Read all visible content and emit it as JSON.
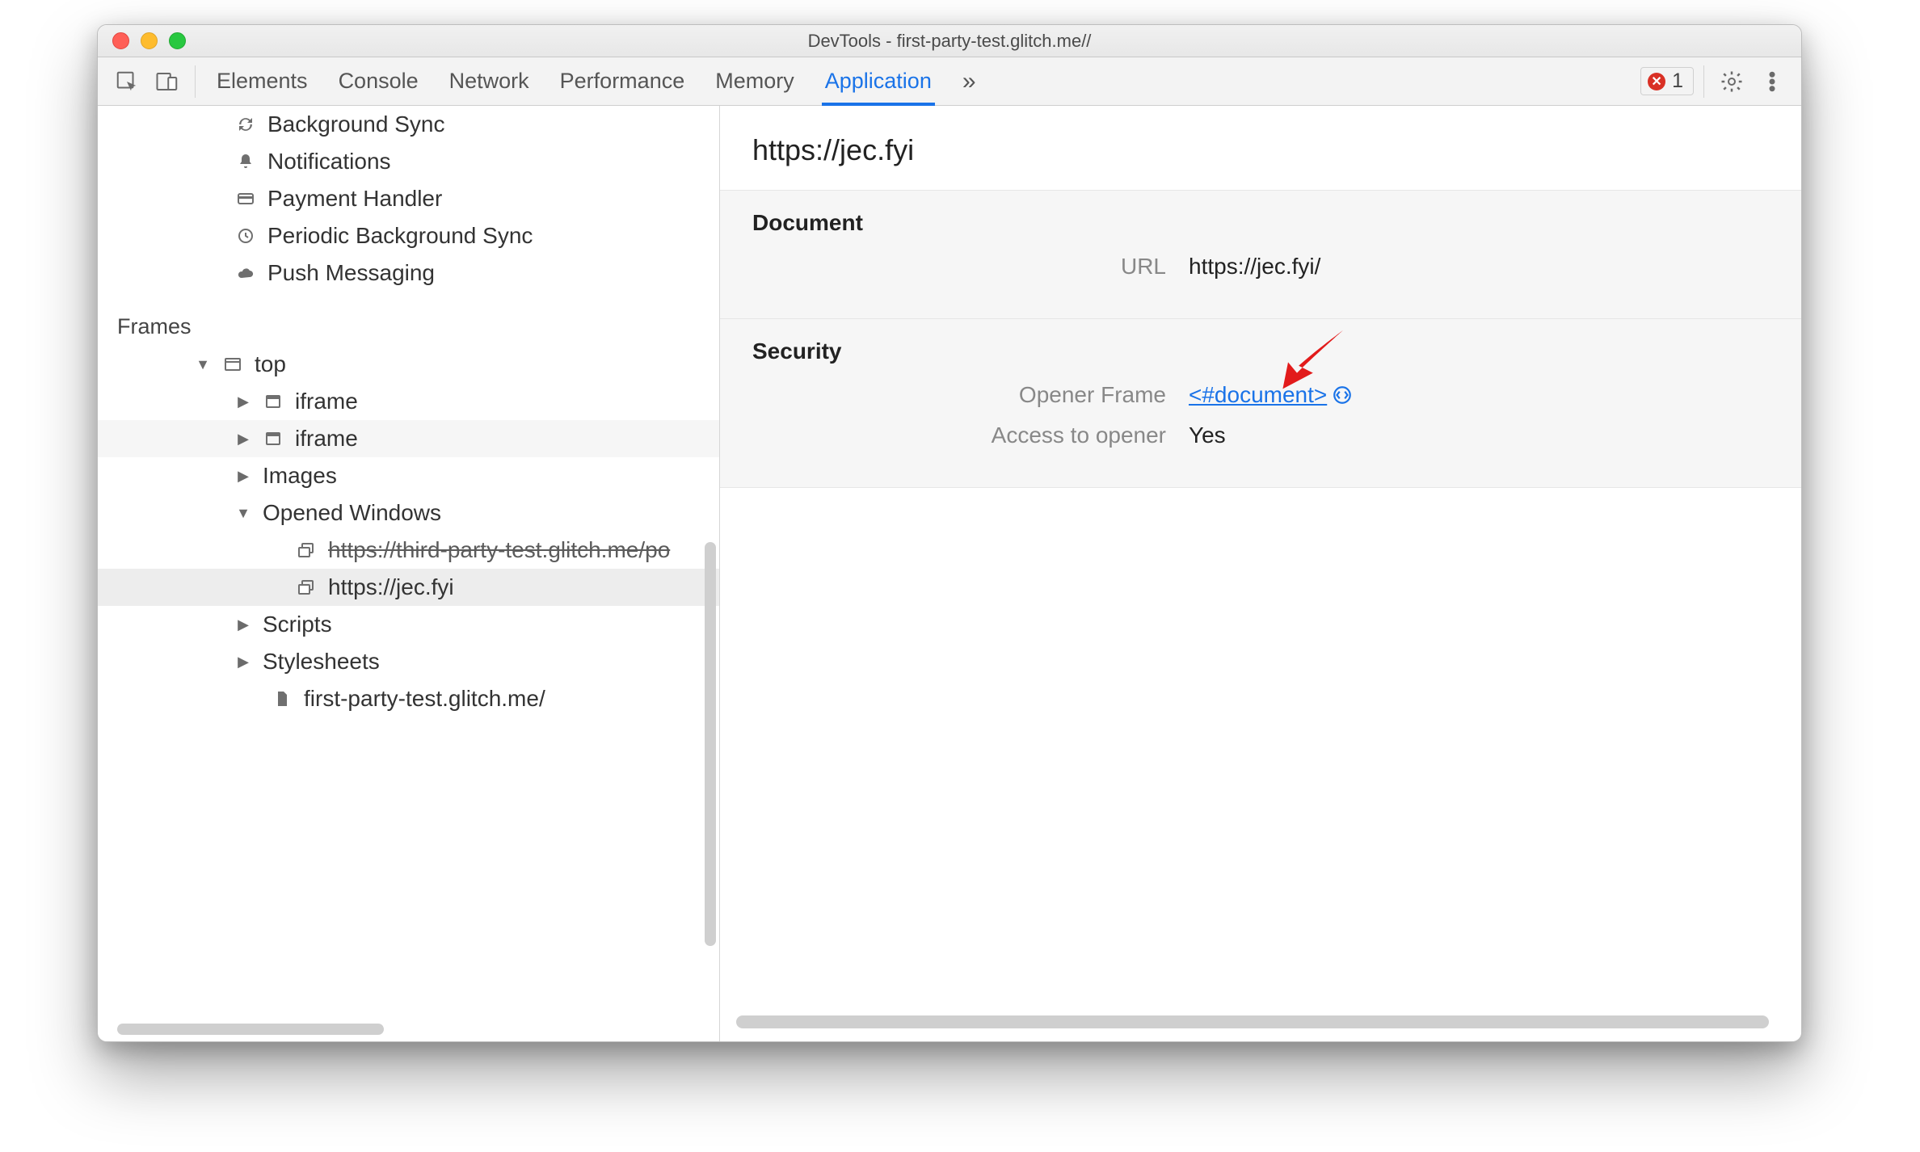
{
  "window": {
    "title": "DevTools - first-party-test.glitch.me//"
  },
  "toolbar": {
    "tabs": {
      "elements": "Elements",
      "console": "Console",
      "network": "Network",
      "performance": "Performance",
      "memory": "Memory",
      "application": "Application"
    },
    "overflow": "»",
    "error_count": "1"
  },
  "sidebar": {
    "bg_sync": "Background Sync",
    "notifications": "Notifications",
    "payment_handler": "Payment Handler",
    "periodic_bg_sync": "Periodic Background Sync",
    "push_messaging": "Push Messaging",
    "frames_heading": "Frames",
    "top": "top",
    "iframe1": "iframe",
    "iframe2": "iframe",
    "images": "Images",
    "opened_windows": "Opened Windows",
    "ow1": "https://third-party-test.glitch.me/po",
    "ow2": "https://jec.fyi",
    "scripts": "Scripts",
    "stylesheets": "Stylesheets",
    "doc_leaf": "first-party-test.glitch.me/"
  },
  "main": {
    "title": "https://jec.fyi",
    "document_heading": "Document",
    "url_label": "URL",
    "url_value": "https://jec.fyi/",
    "security_heading": "Security",
    "opener_label": "Opener Frame",
    "opener_value": "<#document>",
    "access_label": "Access to opener",
    "access_value": "Yes"
  }
}
